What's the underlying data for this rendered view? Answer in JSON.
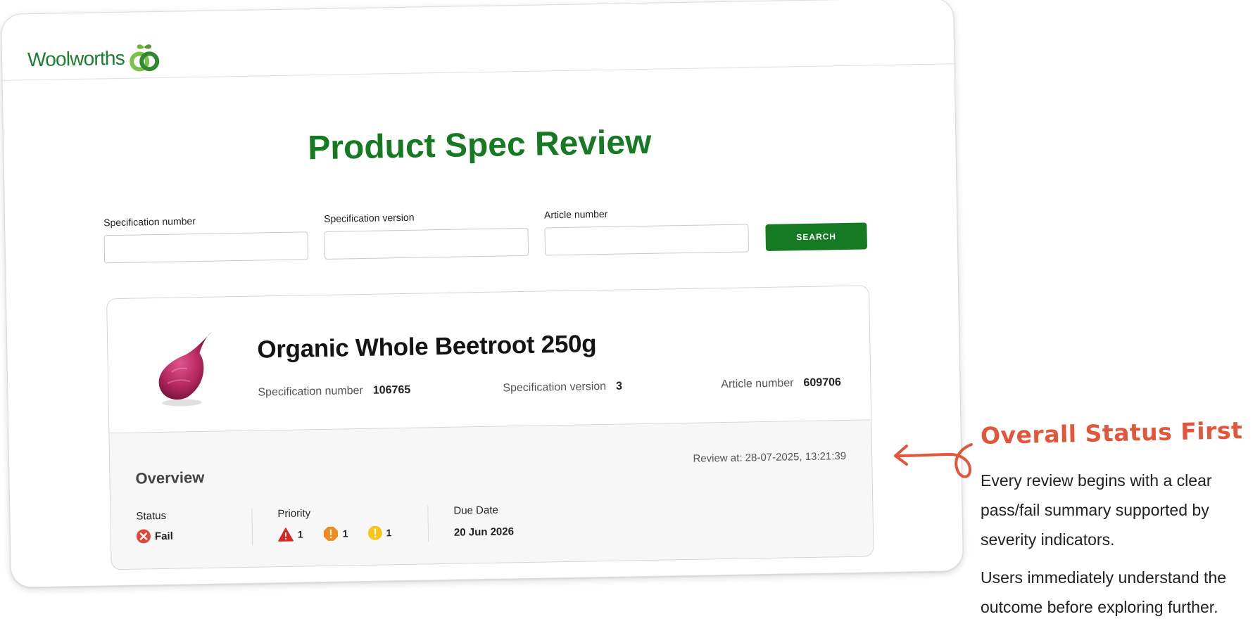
{
  "brand": {
    "name": "Woolworths",
    "color": "#1e7d32"
  },
  "page": {
    "title": "Product Spec Review"
  },
  "search": {
    "spec_number_label": "Specification number",
    "spec_number_value": "",
    "spec_version_label": "Specification version",
    "spec_version_value": "",
    "article_number_label": "Article number",
    "article_number_value": "",
    "button_label": "SEARCH"
  },
  "product": {
    "name": "Organic Whole Beetroot 250g",
    "image_icon": "beetroot-icon",
    "spec_number_label": "Specification number",
    "spec_number": "106765",
    "spec_version_label": "Specification version",
    "spec_version": "3",
    "article_number_label": "Article number",
    "article_number": "609706"
  },
  "overview": {
    "title": "Overview",
    "review_at": "Review at: 28-07-2025, 13:21:39",
    "status_label": "Status",
    "status_value": "Fail",
    "status_icon": "fail-x-icon",
    "status_color": "#e0463a",
    "priority_label": "Priority",
    "priorities": [
      {
        "icon": "critical-triangle-icon",
        "color": "#d7261e",
        "count": "1"
      },
      {
        "icon": "high-octagon-icon",
        "color": "#f08a1c",
        "count": "1"
      },
      {
        "icon": "medium-circle-icon",
        "color": "#f5c518",
        "count": "1"
      }
    ],
    "due_label": "Due Date",
    "due_value": "20 Jun 2026"
  },
  "annotation": {
    "title": "Overall Status First",
    "paragraph1": "Every review begins with a clear pass/fail summary supported by severity indicators.",
    "paragraph2": "Users immediately understand the outcome before exploring further.",
    "accent_color": "#e0573c"
  },
  "colors": {
    "primary_green": "#157a22",
    "card_footer_bg": "#f7f7f7"
  }
}
